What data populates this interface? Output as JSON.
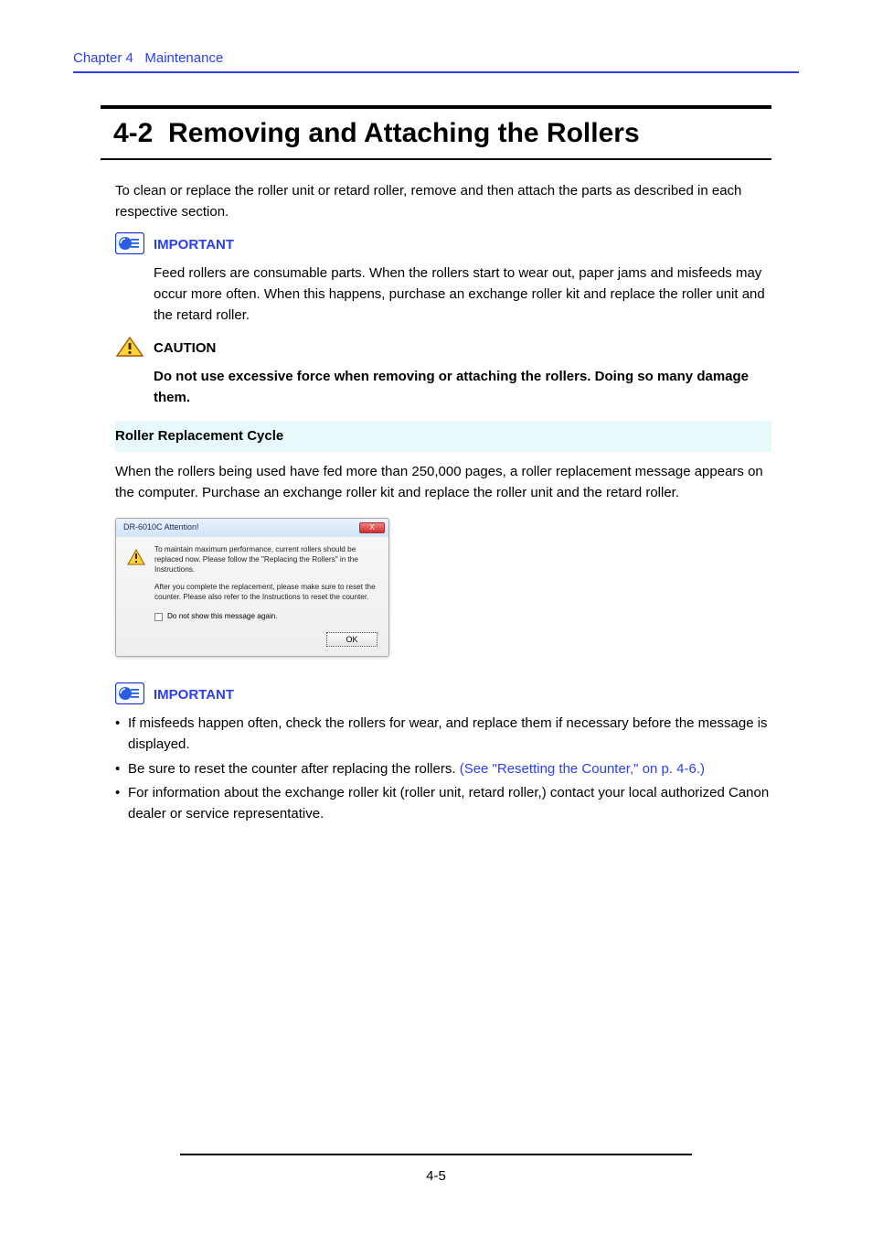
{
  "header": {
    "chapter_label": "Chapter 4",
    "chapter_title": "Maintenance"
  },
  "section": {
    "number": "4-2",
    "title": "Removing and Attaching the Rollers"
  },
  "intro": "To clean or replace the roller unit or retard roller, remove and then attach the parts as described in each respective section.",
  "important1": {
    "heading": "IMPORTANT",
    "text": "Feed rollers are consumable parts. When the rollers start to wear out, paper jams and misfeeds may occur more often. When this happens, purchase an exchange roller kit and replace the roller unit and the retard roller."
  },
  "caution": {
    "heading": "CAUTION",
    "text": "Do not use excessive force when removing or attaching the rollers. Doing so many damage them."
  },
  "subheading": "Roller Replacement Cycle",
  "cycle_text": "When the rollers being used have fed more than 250,000 pages, a roller replacement message appears on the computer. Purchase an exchange roller kit and replace the roller unit and the retard roller.",
  "dialog": {
    "title": "DR-6010C Attention!",
    "close_label": "X",
    "p1": "To maintain maximum performance, current rollers should be replaced now. Please follow the \"Replacing the Rollers\" in the Instructions.",
    "p2": "After you complete the replacement, please make sure to reset the counter. Please also refer to the Instructions to reset the counter.",
    "checkbox_label": "Do not show this message again.",
    "ok_label": "OK"
  },
  "important2": {
    "heading": "IMPORTANT",
    "bullets": [
      {
        "text": "If misfeeds happen often, check the rollers for wear, and replace them if necessary before the message is displayed."
      },
      {
        "text_pre": "Be sure to reset the counter after replacing the rollers. ",
        "link": "(See \"Resetting the Counter,\" on p. 4-6.)"
      },
      {
        "text": "For information about the exchange roller kit (roller unit, retard roller,) contact your local authorized Canon dealer or service representative."
      }
    ]
  },
  "footer": {
    "page_number": "4-5"
  }
}
